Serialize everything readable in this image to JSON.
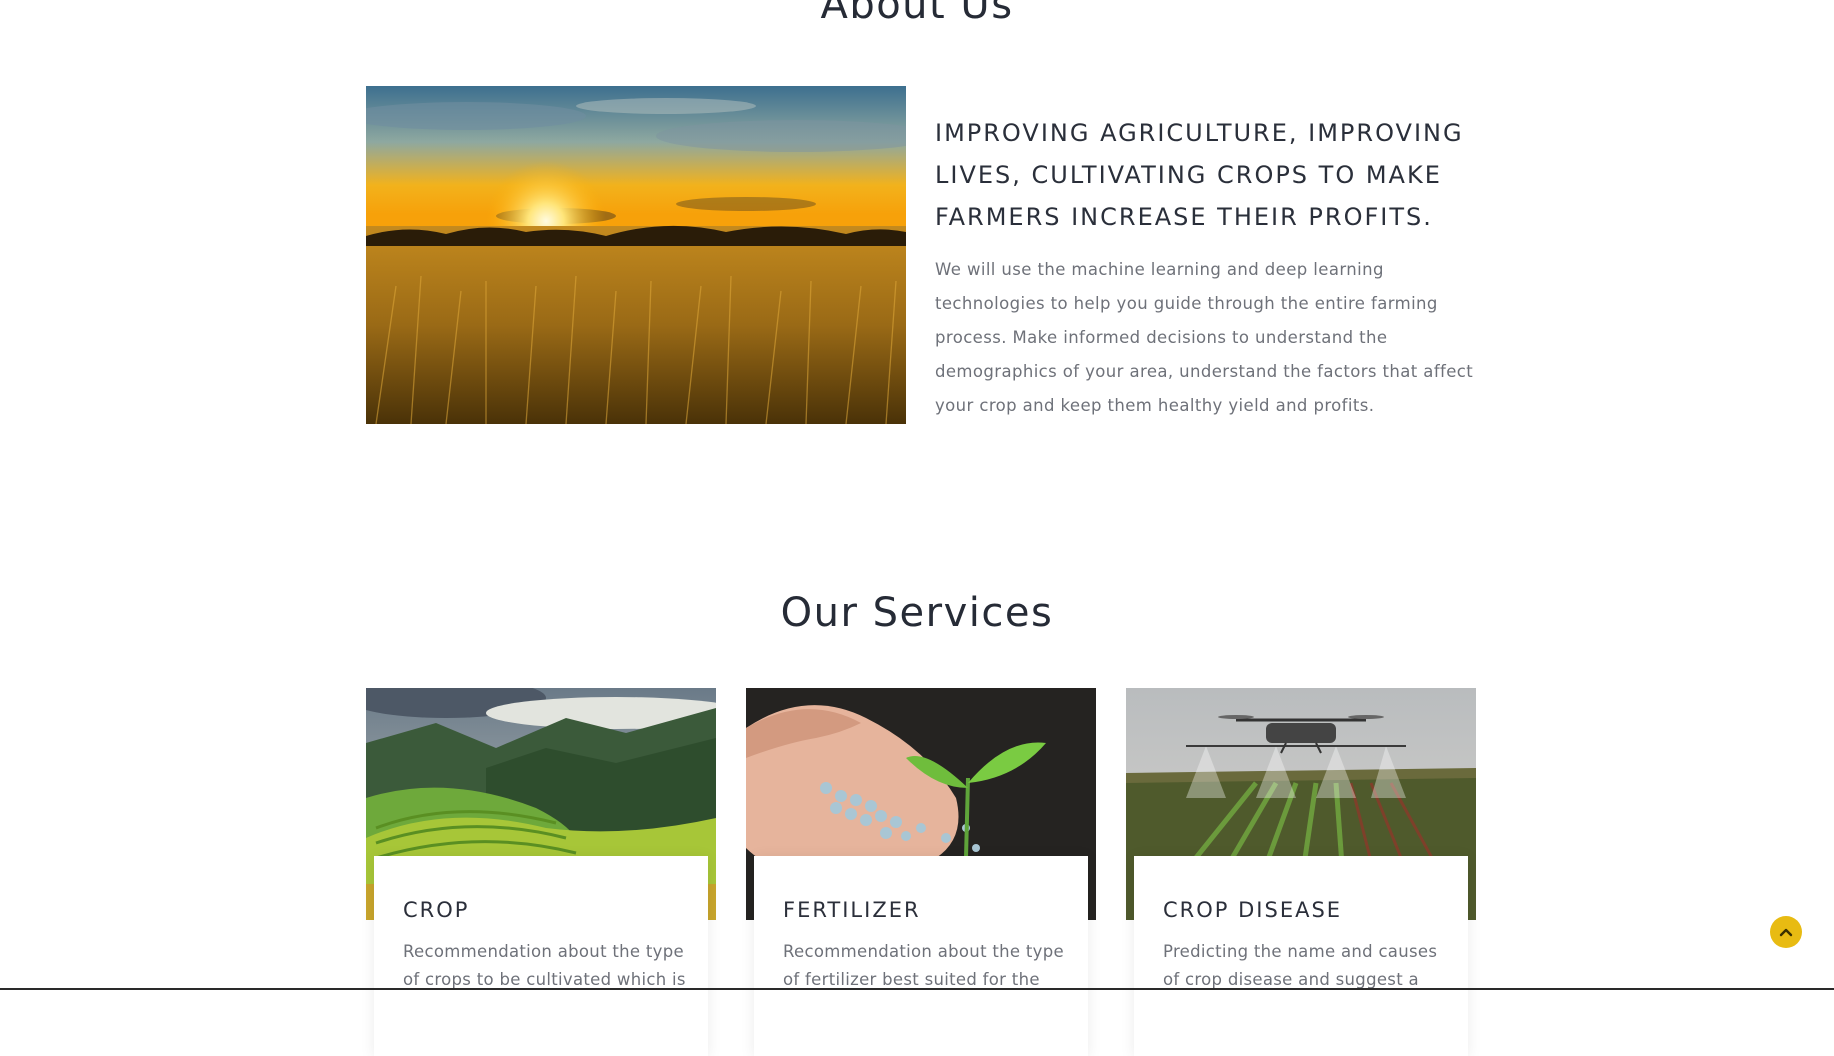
{
  "about": {
    "title": "About Us",
    "image_alt": "Wheat field at sunset",
    "heading": "IMPROVING AGRICULTURE, IMPROVING LIVES, CULTIVATING CROPS TO MAKE FARMERS INCREASE THEIR PROFITS.",
    "text": "We will use the machine learning and deep learning technologies to help you guide through the entire farming process. Make informed decisions to understand the demographics of your area, understand the factors that affect your crop and keep them healthy yield and profits."
  },
  "services": {
    "title": "Our Services",
    "cards": [
      {
        "title": "CROP",
        "text": "Recommendation about the type of crops to be cultivated which is",
        "image": "terraced-rice-fields"
      },
      {
        "title": "FERTILIZER",
        "text": "Recommendation about the type of fertilizer best suited for the",
        "image": "hand-with-fertilizer-and-seedling"
      },
      {
        "title": "CROP DISEASE",
        "text": "Predicting the name and causes of crop disease and suggest a",
        "image": "drone-spraying-crops"
      }
    ]
  },
  "scroll_top": {
    "icon": "chevron-up-icon",
    "color": "#e8bb12"
  }
}
